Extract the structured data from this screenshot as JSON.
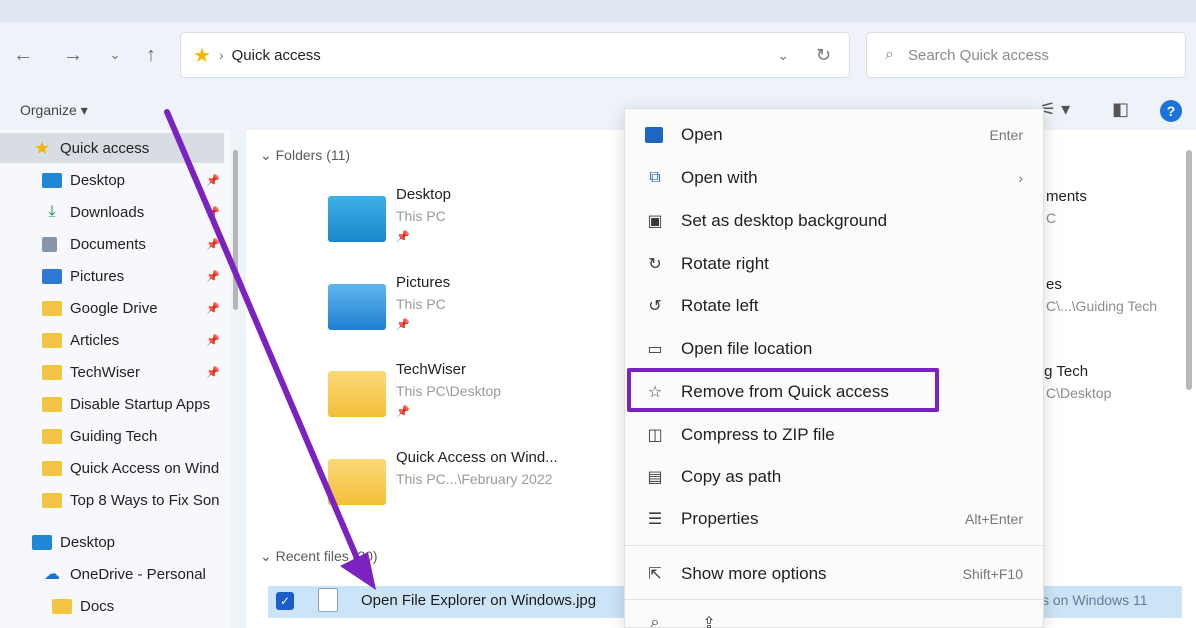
{
  "address_bar": {
    "crumb": "Quick access",
    "separator": "›"
  },
  "search": {
    "placeholder": "Search Quick access"
  },
  "toolbar": {
    "organize_label": "Organize ▾"
  },
  "sidebar": {
    "items": [
      {
        "label": "Quick access",
        "icon": "star-icon",
        "pinned": false,
        "selected": true
      },
      {
        "label": "Desktop",
        "icon": "desktop-icon",
        "pinned": true
      },
      {
        "label": "Downloads",
        "icon": "download-icon",
        "pinned": true
      },
      {
        "label": "Documents",
        "icon": "document-icon",
        "pinned": true
      },
      {
        "label": "Pictures",
        "icon": "pictures-icon",
        "pinned": true
      },
      {
        "label": "Google Drive",
        "icon": "folder-icon",
        "pinned": true
      },
      {
        "label": "Articles",
        "icon": "folder-icon",
        "pinned": true
      },
      {
        "label": "TechWiser",
        "icon": "folder-icon",
        "pinned": true
      },
      {
        "label": "Disable Startup Apps",
        "icon": "folder-icon",
        "pinned": false
      },
      {
        "label": "Guiding Tech",
        "icon": "folder-icon",
        "pinned": false
      },
      {
        "label": "Quick Access on Wind",
        "icon": "folder-icon",
        "pinned": false
      },
      {
        "label": "Top 8 Ways to Fix Son",
        "icon": "folder-icon",
        "pinned": false
      },
      {
        "label": "Desktop",
        "icon": "desktop-icon",
        "pinned": false
      },
      {
        "label": "OneDrive - Personal",
        "icon": "cloud-icon",
        "pinned": false
      },
      {
        "label": "Docs",
        "icon": "folder-icon",
        "pinned": false
      }
    ]
  },
  "main": {
    "folders_header": "Folders (11)",
    "folders": [
      {
        "name": "Desktop",
        "location": "This PC"
      },
      {
        "name": "Pictures",
        "location": "This PC"
      },
      {
        "name": "TechWiser",
        "location": "This PC\\Desktop"
      },
      {
        "name": "Quick Access on Wind...",
        "location": "This PC...\\February 2022"
      }
    ],
    "right_column": [
      {
        "name": "ments",
        "location": "C"
      },
      {
        "name": "es",
        "location": "C\\...\\Guiding Tech"
      },
      {
        "name": "ıg Tech",
        "location": "C\\Desktop"
      }
    ],
    "recent_header": "Recent files (20)",
    "recent_file": {
      "name": "Open File Explorer on Windows.jpg",
      "location_tail": "s on Windows 11"
    }
  },
  "context_menu": {
    "items": [
      {
        "label": "Open",
        "shortcut": "Enter",
        "icon": "open-image-icon"
      },
      {
        "label": "Open with",
        "shortcut": "›",
        "icon": "open-with-icon"
      },
      {
        "label": "Set as desktop background",
        "shortcut": "",
        "icon": "wallpaper-icon"
      },
      {
        "label": "Rotate right",
        "shortcut": "",
        "icon": "rotate-right-icon"
      },
      {
        "label": "Rotate left",
        "shortcut": "",
        "icon": "rotate-left-icon"
      },
      {
        "label": "Open file location",
        "shortcut": "",
        "icon": "folder-outline-icon"
      },
      {
        "label": "Remove from Quick access",
        "shortcut": "",
        "icon": "unpin-star-icon"
      },
      {
        "label": "Compress to ZIP file",
        "shortcut": "",
        "icon": "zip-icon"
      },
      {
        "label": "Copy as path",
        "shortcut": "",
        "icon": "copy-path-icon"
      },
      {
        "label": "Properties",
        "shortcut": "Alt+Enter",
        "icon": "properties-icon"
      },
      {
        "label": "Show more options",
        "shortcut": "Shift+F10",
        "icon": "more-options-icon"
      }
    ]
  },
  "colors": {
    "highlight": "#7b22c0",
    "accent": "#1a73d9",
    "selection": "#cce4f7"
  }
}
